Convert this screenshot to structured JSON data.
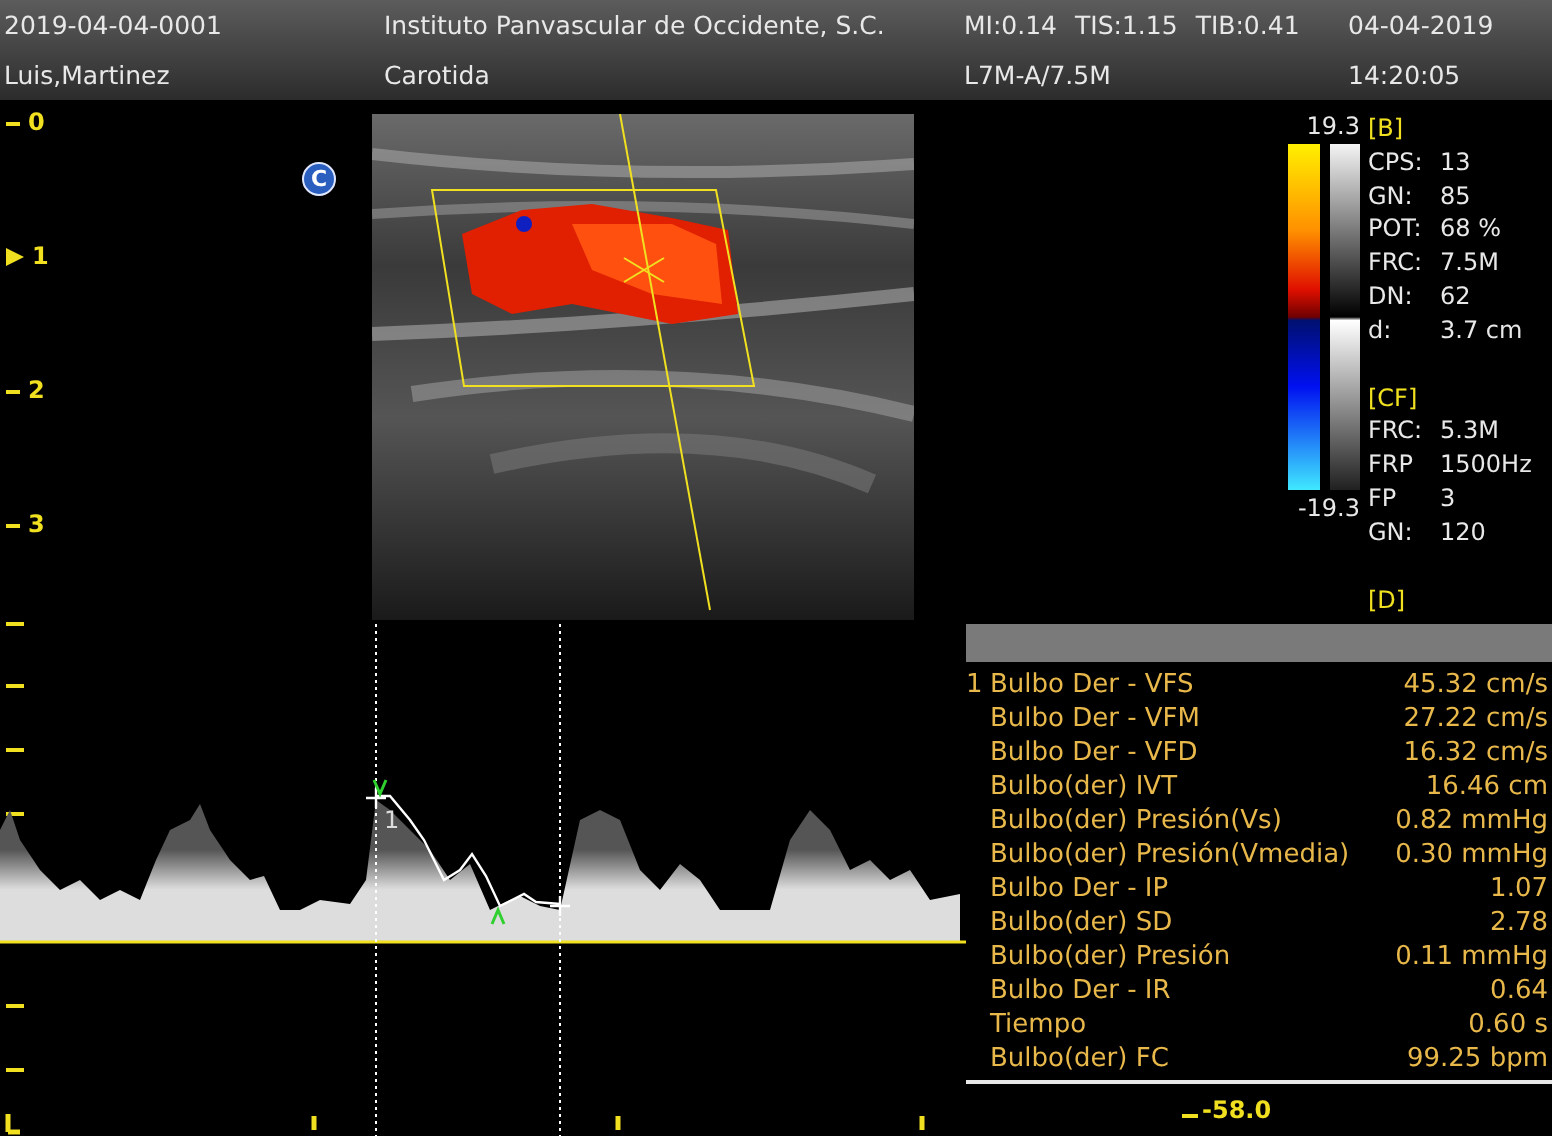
{
  "header": {
    "exam_id": "2019-04-04-0001",
    "institution": "Instituto Panvascular de Occidente, S.C.",
    "indices": [
      "MI:0.14",
      "TIS:1.15",
      "TIB:0.41"
    ],
    "date": "04-04-2019",
    "patient": "Luis,Martinez",
    "study": "Carotida",
    "probe": "L7M-A/7.5M",
    "time": "14:20:05"
  },
  "depth_scale": [
    {
      "label": "0",
      "focus": false
    },
    {
      "label": "1",
      "focus": true
    },
    {
      "label": "2",
      "focus": false
    },
    {
      "label": "3",
      "focus": false
    }
  ],
  "mode_badge": "C",
  "color_scale": {
    "max": "19.3",
    "min": "-19.3"
  },
  "parameters": [
    {
      "title": "[B]",
      "items": [
        {
          "label": "CPS:",
          "value": "13"
        },
        {
          "label": "GN:",
          "value": "85"
        },
        {
          "label": "POT:",
          "value": "68 %"
        },
        {
          "label": "FRC:",
          "value": "7.5M"
        },
        {
          "label": "DN:",
          "value": "62"
        },
        {
          "label": "d:",
          "value": "3.7 cm"
        }
      ]
    },
    {
      "title": "[CF]",
      "items": [
        {
          "label": "FRC:",
          "value": "5.3M"
        },
        {
          "label": "FRP",
          "value": "1500Hz"
        },
        {
          "label": "FP",
          "value": "3"
        },
        {
          "label": "GN:",
          "value": "120"
        }
      ]
    },
    {
      "title": "[D]"
    }
  ],
  "spectrum": {
    "marker": "1"
  },
  "measurements": [
    {
      "index": "1",
      "label": "Bulbo Der - VFS",
      "value": "45.32 cm/s"
    },
    {
      "label": "Bulbo Der - VFM",
      "value": "27.22 cm/s"
    },
    {
      "label": "Bulbo Der - VFD",
      "value": "16.32 cm/s"
    },
    {
      "label": "Bulbo(der) IVT",
      "value": "16.46 cm"
    },
    {
      "label": "Bulbo(der) Presión(Vs)",
      "value": "0.82 mmHg"
    },
    {
      "label": "Bulbo(der) Presión(Vmedia)",
      "value": "0.30 mmHg"
    },
    {
      "label": "Bulbo Der - IP",
      "value": "1.07"
    },
    {
      "label": "Bulbo(der) SD",
      "value": "2.78"
    },
    {
      "label": "Bulbo(der) Presión",
      "value": "0.11 mmHg"
    },
    {
      "label": "Bulbo Der - IR",
      "value": "0.64"
    },
    {
      "label": "Tiempo",
      "value": "0.60 s"
    },
    {
      "label": "Bulbo(der) FC",
      "value": "99.25 bpm"
    }
  ],
  "velocity_scale_min": "-58.0"
}
